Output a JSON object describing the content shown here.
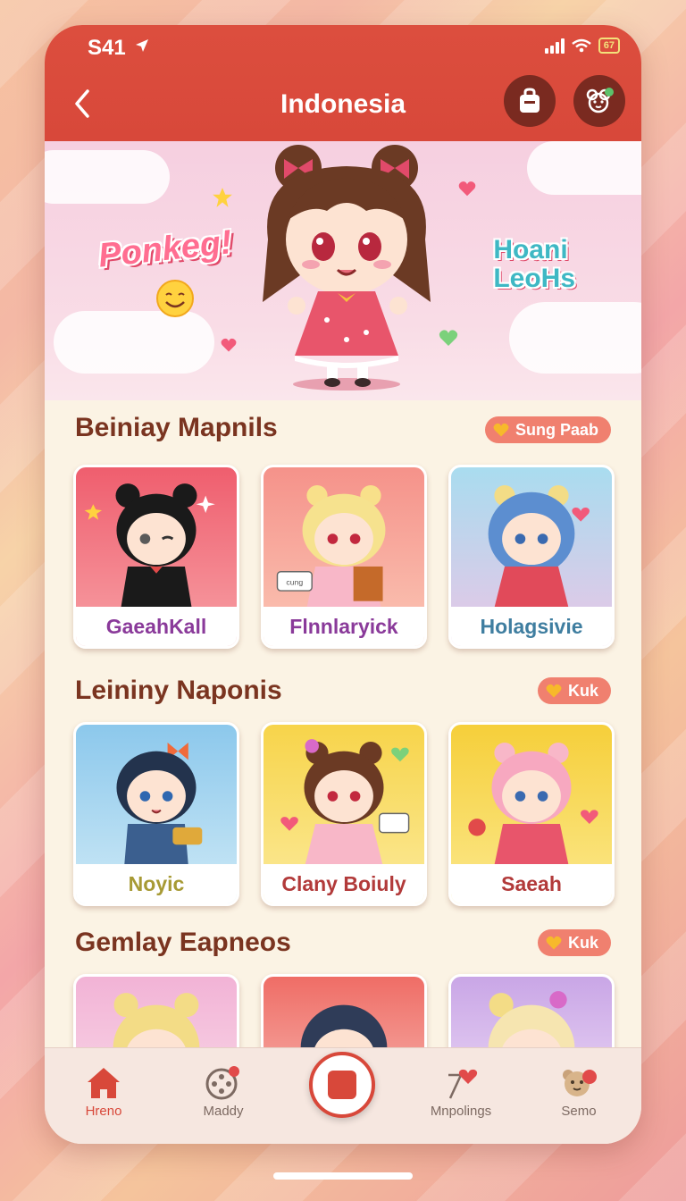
{
  "status": {
    "time": "S41",
    "battery": "67"
  },
  "header": {
    "title": "Indonesia"
  },
  "banner": {
    "left_text": "Ponkeg!",
    "right_text_line1": "Hoani",
    "right_text_line2": "LeoHs"
  },
  "sections": [
    {
      "title": "Beiniay Mapnils",
      "pill": "Sung Paab",
      "cards": [
        {
          "label": "GaeahKall",
          "label_color": "#8a3a9a"
        },
        {
          "label": "Flnnlaryick",
          "label_color": "#8a3a9a"
        },
        {
          "label": "Holagsivie",
          "label_color": "#3f7ea0"
        }
      ]
    },
    {
      "title": "Leininy Naponis",
      "pill": "Kuk",
      "cards": [
        {
          "label": "Noyic",
          "label_color": "#a79a35"
        },
        {
          "label": "Clany Boiuly",
          "label_color": "#b23a3a"
        },
        {
          "label": "Saeah",
          "label_color": "#b23a3a"
        }
      ]
    },
    {
      "title": "Gemlay Eapneos",
      "pill": "Kuk"
    }
  ],
  "tabs": [
    {
      "label": "Hreno",
      "icon": "house-icon",
      "active": true
    },
    {
      "label": "Maddy",
      "icon": "film-reel-icon"
    },
    {
      "label": "",
      "icon": "stop-button-icon"
    },
    {
      "label": "Mnpolings",
      "icon": "heart-pin-icon"
    },
    {
      "label": "Semo",
      "icon": "bear-face-icon"
    }
  ],
  "colors": {
    "header": "#d8483a",
    "accent": "#f0806f",
    "section_title": "#7a3420"
  }
}
